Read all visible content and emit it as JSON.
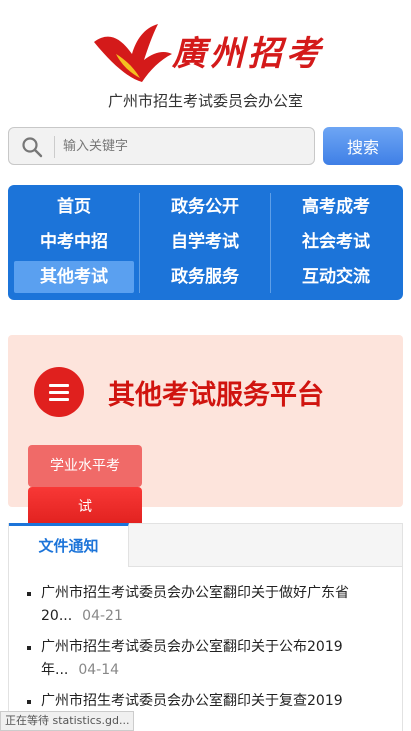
{
  "header": {
    "logo_text": "廣州招考",
    "subtitle": "广州市招生考试委员会办公室"
  },
  "search": {
    "placeholder": "输入关键字",
    "button_label": "搜索"
  },
  "nav": {
    "items": [
      {
        "label": "首页"
      },
      {
        "label": "政务公开"
      },
      {
        "label": "高考成考"
      },
      {
        "label": "中考中招"
      },
      {
        "label": "自学考试"
      },
      {
        "label": "社会考试"
      },
      {
        "label": "其他考试",
        "active": true
      },
      {
        "label": "政务服务"
      },
      {
        "label": "互动交流"
      }
    ]
  },
  "banner": {
    "title": "其他考试服务平台",
    "tag_line1": "学业水平考",
    "tag_line2": "试"
  },
  "panel": {
    "tab_label": "文件通知",
    "news": [
      {
        "line1": "广州市招生考试委员会办公室翻印关于做好广东省",
        "line2": "20...",
        "date": "04-21"
      },
      {
        "line1": "广州市招生考试委员会办公室翻印关于公布2019",
        "line2": "年...",
        "date": "04-14"
      },
      {
        "line1": "广州市招生考试委员会办公室翻印关于复查2019",
        "line2": "",
        "date": ""
      }
    ]
  },
  "status": {
    "text": "正在等待 statistics.gd..."
  },
  "colors": {
    "brand_red": "#d41a1a",
    "nav_blue": "#1c74d9",
    "search_blue": "#3f7fe6",
    "banner_bg": "#fde4dc"
  }
}
